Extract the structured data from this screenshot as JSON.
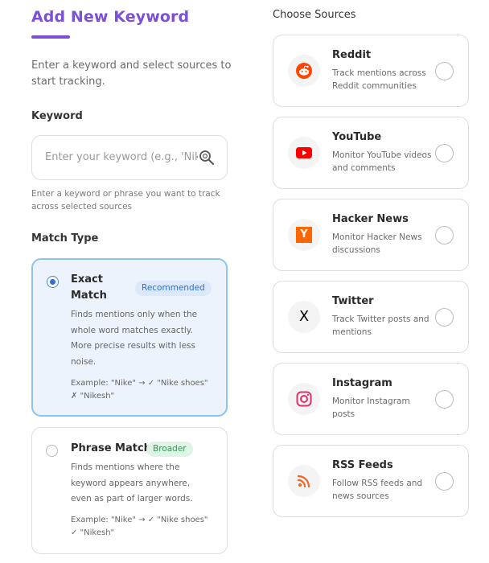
{
  "form": {
    "title": "Add New Keyword",
    "intro": "Enter a keyword and select sources to start tracking.",
    "keyword_label": "Keyword",
    "keyword_value": "",
    "keyword_placeholder": "Enter your keyword (e.g., 'Nike', 'R",
    "keyword_helper": "Enter a keyword or phrase you want to track across selected sources",
    "match_type_label": "Match Type",
    "match_types": [
      {
        "title_line1": "Exact",
        "title_line2": "Match",
        "badge": "Recommended",
        "selected": true,
        "desc_lines": [
          "Finds mentions only when the",
          "whole word matches exactly.",
          "More precise results with less",
          "noise."
        ],
        "example_lines": [
          "Example: \"Nike\" → ✓ \"Nike shoes\"",
          "✗ \"Nikesh\""
        ]
      },
      {
        "title": "Phrase Match",
        "badge": "Broader",
        "selected": false,
        "desc_lines": [
          "Finds mentions where the",
          "keyword appears anywhere,",
          "even as part of larger words."
        ],
        "example_lines": [
          "Example: \"Nike\" → ✓ \"Nike shoes\"",
          "✓ \"Nikesh\""
        ]
      }
    ]
  },
  "sources": {
    "heading": "Choose Sources",
    "items": [
      {
        "name": "Reddit",
        "desc_lines": [
          "Track mentions across",
          "Reddit communities"
        ],
        "icon": "reddit-icon",
        "color": "#ff4500",
        "selected": false
      },
      {
        "name": "YouTube",
        "desc_lines": [
          "Monitor YouTube videos",
          "and comments"
        ],
        "icon": "youtube-icon",
        "color": "#ff0000",
        "selected": false
      },
      {
        "name": "Hacker News",
        "desc_lines": [
          "Monitor Hacker News",
          "discussions"
        ],
        "icon": "hacker-news-icon",
        "color": "#ff6600",
        "glyph": "Y",
        "selected": false
      },
      {
        "name": "Twitter",
        "desc_lines": [
          "Track Twitter posts and",
          "mentions"
        ],
        "icon": "x-twitter-icon",
        "color": "#000000",
        "glyph": "X",
        "selected": false
      },
      {
        "name": "Instagram",
        "desc_lines": [
          "Monitor Instagram",
          "posts"
        ],
        "icon": "instagram-icon",
        "color": "#e1306c",
        "selected": false
      },
      {
        "name": "RSS Feeds",
        "desc_lines": [
          "Follow RSS feeds and",
          "news sources"
        ],
        "icon": "rss-icon",
        "color": "#f26522",
        "selected": false
      }
    ]
  },
  "colors": {
    "accent": "#7b4fd6",
    "selected_border": "#8fc1f3",
    "selected_bg": "#ecf3fd",
    "recommended_badge": "#2f6fd6",
    "broader_badge": "#2f9a57"
  }
}
